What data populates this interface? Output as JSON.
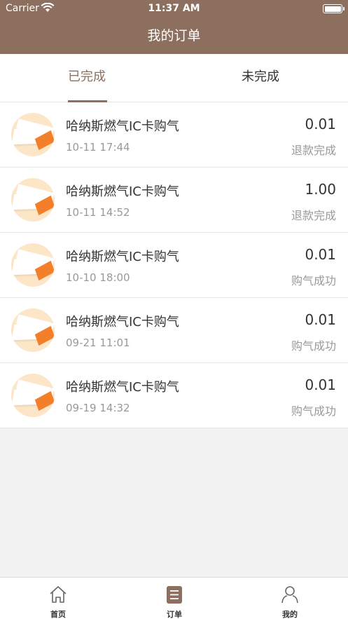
{
  "status_bar": {
    "carrier": "Carrier",
    "time": "11:37 AM"
  },
  "nav": {
    "title": "我的订单"
  },
  "tabs": [
    {
      "label": "已完成",
      "active": true
    },
    {
      "label": "未完成",
      "active": false
    }
  ],
  "orders": [
    {
      "title": "哈纳斯燃气IC卡购气",
      "datetime": "10-11 17:44",
      "amount": "0.01",
      "status": "退款完成"
    },
    {
      "title": "哈纳斯燃气IC卡购气",
      "datetime": "10-11 14:52",
      "amount": "1.00",
      "status": "退款完成"
    },
    {
      "title": "哈纳斯燃气IC卡购气",
      "datetime": "10-10 18:00",
      "amount": "0.01",
      "status": "购气成功"
    },
    {
      "title": "哈纳斯燃气IC卡购气",
      "datetime": "09-21 11:01",
      "amount": "0.01",
      "status": "购气成功"
    },
    {
      "title": "哈纳斯燃气IC卡购气",
      "datetime": "09-19 14:32",
      "amount": "0.01",
      "status": "购气成功"
    }
  ],
  "tabbar": [
    {
      "label": "首页",
      "icon": "home-icon"
    },
    {
      "label": "订单",
      "icon": "orders-icon",
      "active": true
    },
    {
      "label": "我的",
      "icon": "profile-icon"
    }
  ],
  "colors": {
    "primary": "#8c6f5e",
    "accent": "#f47f2a"
  }
}
